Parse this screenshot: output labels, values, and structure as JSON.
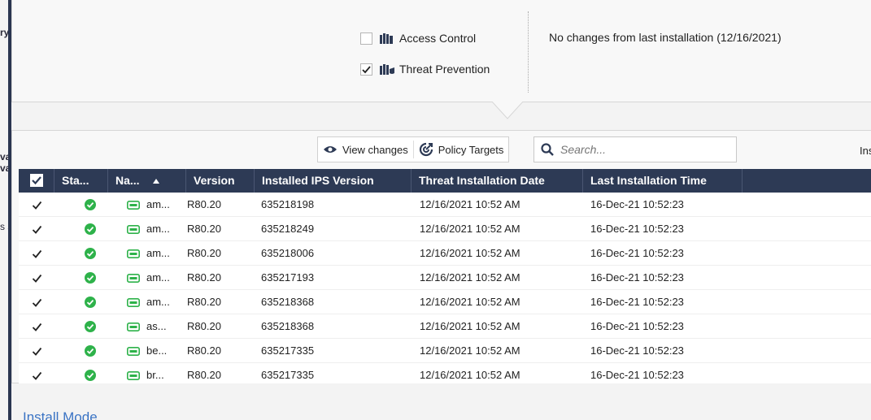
{
  "left_fragments": [
    "ry",
    "va",
    "va",
    "s s"
  ],
  "policies": [
    {
      "label": "Access Control",
      "checked": false
    },
    {
      "label": "Threat Prevention",
      "checked": true
    }
  ],
  "install_status": "No changes from last installation (12/16/2021)",
  "toolbar": {
    "view_changes": "View changes",
    "policy_targets": "Policy Targets",
    "search_placeholder": "Search...",
    "ins_fragment": "Ins"
  },
  "table": {
    "columns": [
      "Sta...",
      "Na...",
      "Version",
      "Installed IPS Version",
      "Threat Installation Date",
      "Last Installation Time"
    ],
    "rows": [
      {
        "name": "am...",
        "version": "R80.20",
        "ips": "635218198",
        "threat_date": "12/16/2021 10:52 AM",
        "last_time": "16-Dec-21 10:52:23"
      },
      {
        "name": "am...",
        "version": "R80.20",
        "ips": "635218249",
        "threat_date": "12/16/2021 10:52 AM",
        "last_time": "16-Dec-21 10:52:23"
      },
      {
        "name": "am...",
        "version": "R80.20",
        "ips": "635218006",
        "threat_date": "12/16/2021 10:52 AM",
        "last_time": "16-Dec-21 10:52:23"
      },
      {
        "name": "am...",
        "version": "R80.20",
        "ips": "635217193",
        "threat_date": "12/16/2021 10:52 AM",
        "last_time": "16-Dec-21 10:52:23"
      },
      {
        "name": "am...",
        "version": "R80.20",
        "ips": "635218368",
        "threat_date": "12/16/2021 10:52 AM",
        "last_time": "16-Dec-21 10:52:23"
      },
      {
        "name": "as...",
        "version": "R80.20",
        "ips": "635218368",
        "threat_date": "12/16/2021 10:52 AM",
        "last_time": "16-Dec-21 10:52:23"
      },
      {
        "name": "be...",
        "version": "R80.20",
        "ips": "635217335",
        "threat_date": "12/16/2021 10:52 AM",
        "last_time": "16-Dec-21 10:52:23"
      },
      {
        "name": "br...",
        "version": "R80.20",
        "ips": "635217335",
        "threat_date": "12/16/2021 10:52 AM",
        "last_time": "16-Dec-21 10:52:23"
      }
    ]
  },
  "install_mode_label": "Install Mode",
  "colors": {
    "header_bg": "#2d3a55",
    "status_ok": "#2eb24a",
    "gateway_icon": "#2eb24a",
    "link": "#3a73c4"
  },
  "icons": {
    "view_changes": "eye-icon",
    "policy_targets": "target-icon",
    "search": "search-icon",
    "policy": "book-icon",
    "status": "check-circle-icon",
    "gateway": "gateway-icon",
    "sort": "sort-ascending-icon"
  }
}
